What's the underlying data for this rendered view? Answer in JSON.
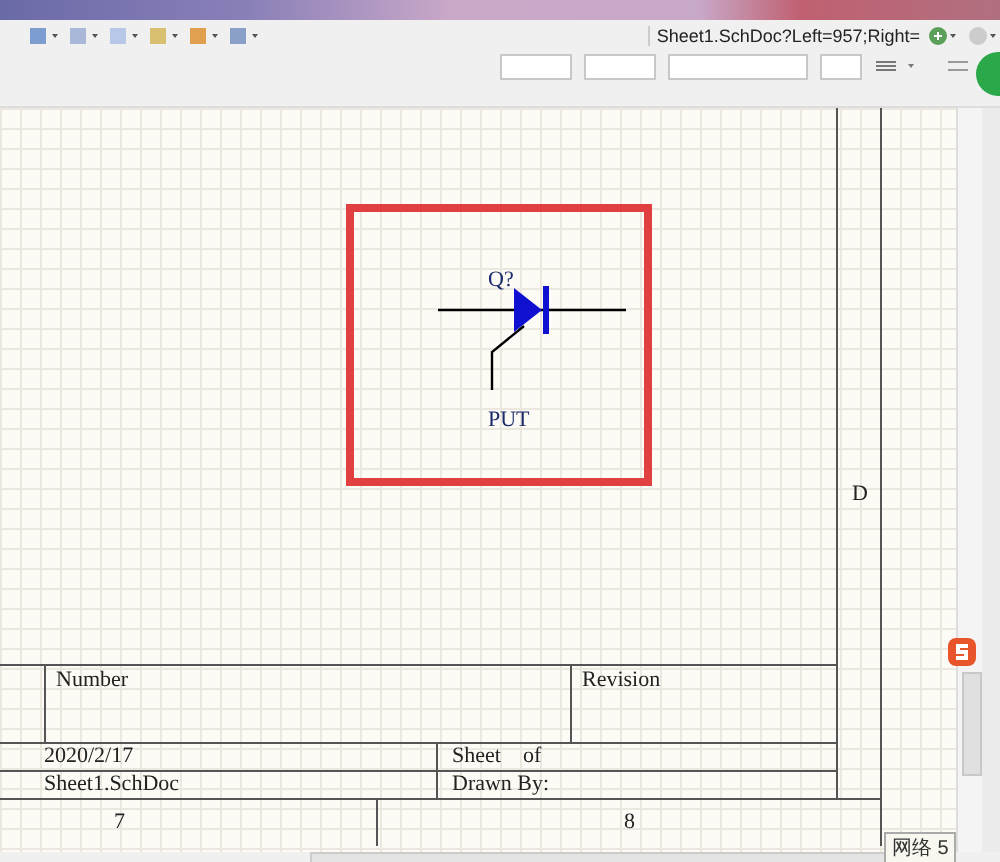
{
  "toolbar": {
    "address": "Sheet1.SchDoc?Left=957;Right="
  },
  "schematic": {
    "component": {
      "designator": "Q?",
      "comment": "PUT"
    },
    "zone_label": "D",
    "title_block": {
      "number_label": "Number",
      "revision_label": "Revision",
      "date": "2020/2/17",
      "sheet_label": "Sheet    of",
      "file_name": "Sheet1.SchDoc",
      "drawn_by_label": "Drawn By:"
    },
    "column_labels": [
      "7",
      "8"
    ]
  },
  "tooltip": {
    "text": "网络 5"
  }
}
